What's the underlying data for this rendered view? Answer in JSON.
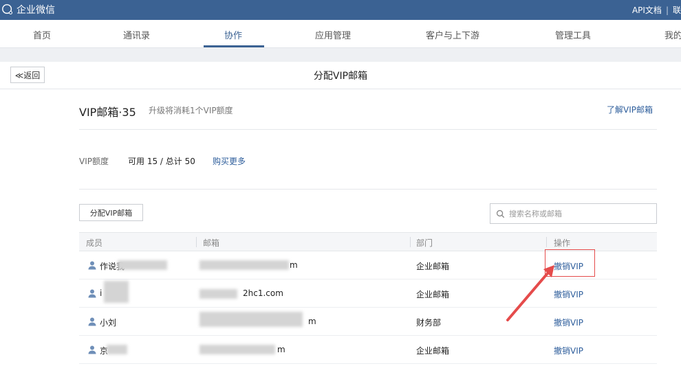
{
  "app": {
    "title": "企业微信",
    "top_links": [
      "API文档",
      "|",
      "联"
    ]
  },
  "nav": {
    "items": [
      {
        "label": "首页",
        "active": false
      },
      {
        "label": "通讯录",
        "active": false
      },
      {
        "label": "协作",
        "active": true
      },
      {
        "label": "应用管理",
        "active": false
      },
      {
        "label": "客户与上下游",
        "active": false
      },
      {
        "label": "管理工具",
        "active": false
      },
      {
        "label": "我的",
        "active": false
      }
    ]
  },
  "header": {
    "back_label": "≪返回",
    "title": "分配VIP邮箱"
  },
  "summary": {
    "heading": "VIP邮箱·35",
    "subtext": "升级将消耗1个VIP额度",
    "learn_more": "了解VIP邮箱"
  },
  "quota": {
    "label": "VIP额度",
    "value": "可用 15 / 总计 50",
    "buy_more": "购买更多"
  },
  "toolbar": {
    "assign_label": "分配VIP邮箱",
    "search_placeholder": "搜索名称或邮箱"
  },
  "table": {
    "columns": [
      "成员",
      "邮箱",
      "部门",
      "操作"
    ],
    "rows": [
      {
        "member": "作说我",
        "email": "m",
        "department": "企业邮箱",
        "action": "撤销VIP"
      },
      {
        "member": "i",
        "email": "2hc1.com",
        "department": "企业邮箱",
        "action": "撤销VIP"
      },
      {
        "member": "小刘",
        "email": "m",
        "department": "财务部",
        "action": "撤销VIP"
      },
      {
        "member": "京",
        "email": "m",
        "department": "企业邮箱",
        "action": "撤销VIP"
      }
    ]
  },
  "colors": {
    "brand": "#3b6293",
    "link": "#2d5d9b",
    "annotation": "#e54b4b"
  }
}
